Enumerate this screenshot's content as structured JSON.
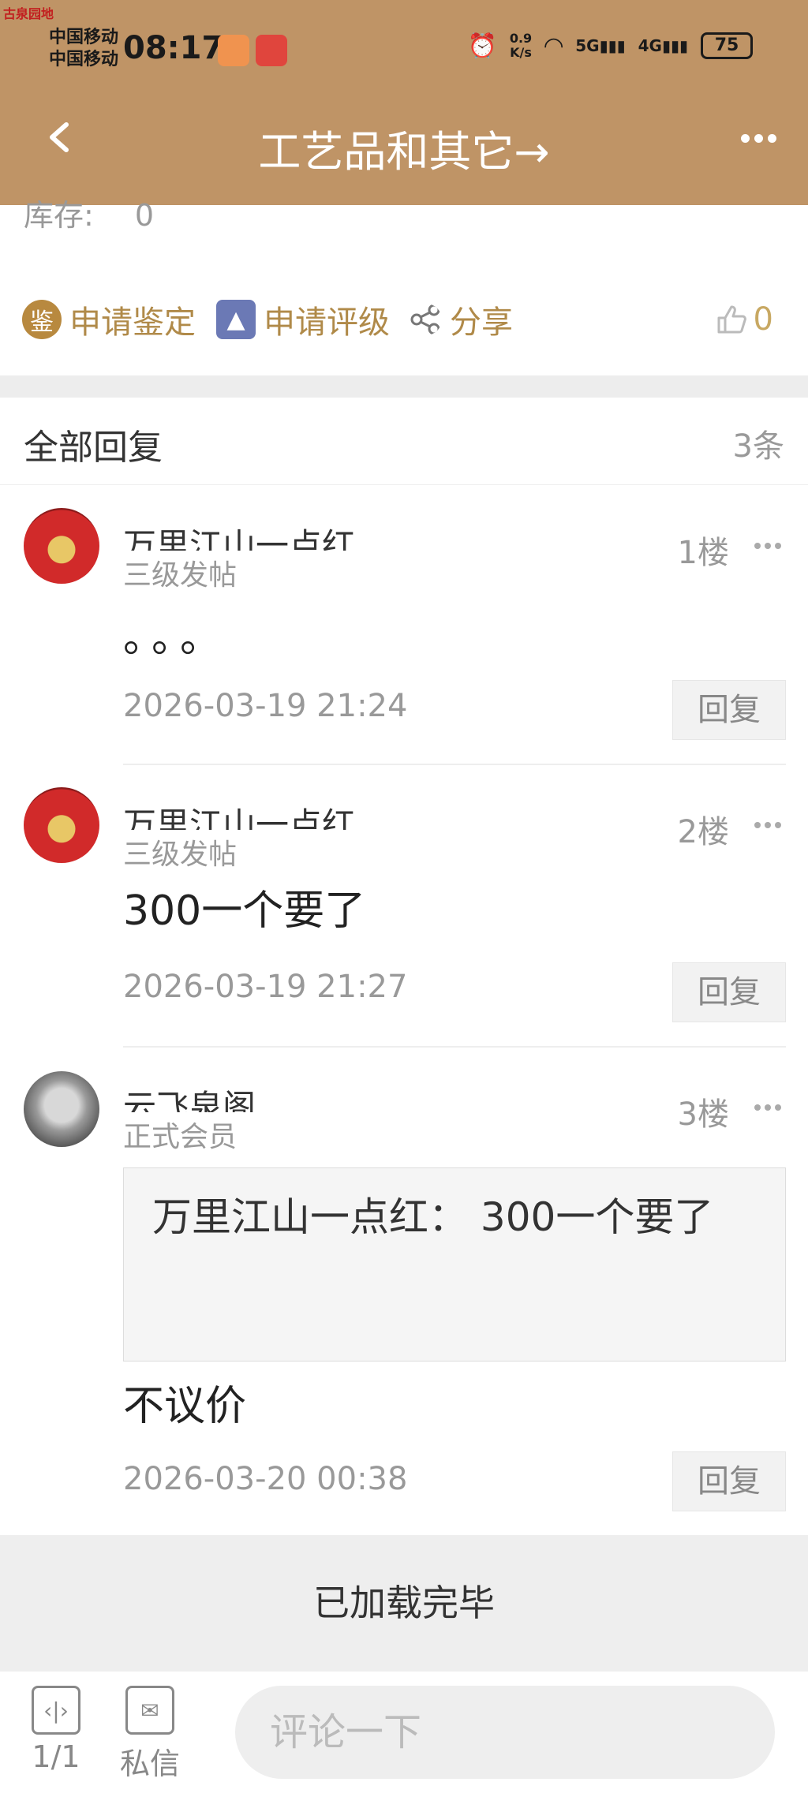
{
  "status": {
    "badge": "古泉园地",
    "carrier1": "中国移动",
    "carrier2": "中国移动",
    "time": "08:17",
    "speed": "0.9\nK/s",
    "sig5g": "5G",
    "sig4g": "4G",
    "battery": "75"
  },
  "nav": {
    "title": "工艺品和其它→"
  },
  "stock": {
    "label": "库存:",
    "value": "0"
  },
  "actions": {
    "appraise_icon": "鉴",
    "appraise": "申请鉴定",
    "grade": "申请评级",
    "share": "分享",
    "likes": "0"
  },
  "replies": {
    "label": "全部回复",
    "count": "3条",
    "items": [
      {
        "user": "万里江山一点红",
        "level": "三级发帖",
        "floor": "1楼",
        "text": "。。。",
        "time": "2026-03-19 21:24",
        "reply": "回复"
      },
      {
        "user": "万里江山一点红",
        "level": "三级发帖",
        "floor": "2楼",
        "text": "300一个要了",
        "time": "2026-03-19 21:27",
        "reply": "回复"
      },
      {
        "user": "云飞泉阁",
        "level": "正式会员",
        "floor": "3楼",
        "quote": "万里江山一点红： 300一个要了",
        "text": "不议价",
        "time": "2026-03-20 00:38",
        "reply": "回复"
      }
    ]
  },
  "loaded": "已加载完毕",
  "bottom": {
    "pages": "1/1",
    "dm": "私信",
    "comment_placeholder": "评论一下"
  }
}
